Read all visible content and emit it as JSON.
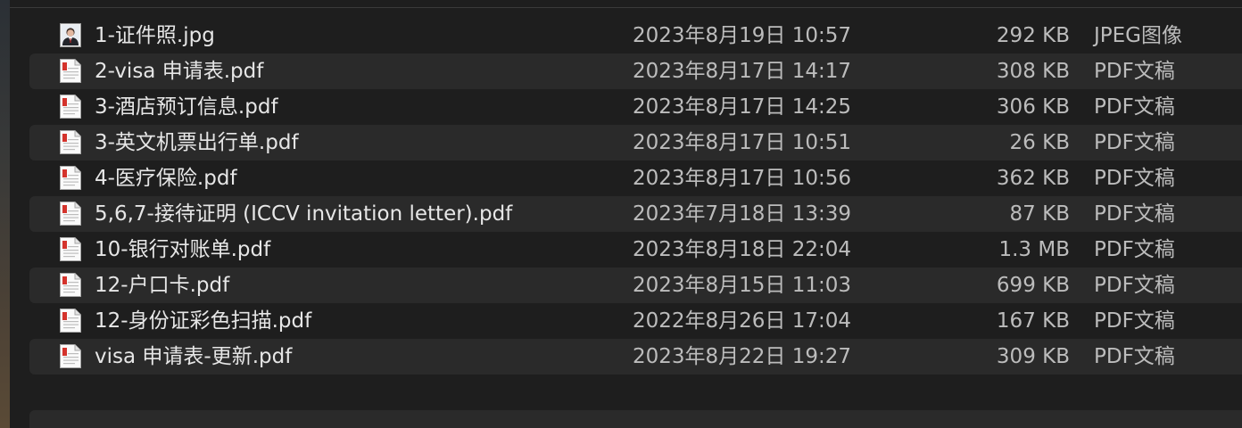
{
  "files": [
    {
      "name": "1-证件照.jpg",
      "date": "2023年8月19日 10:57",
      "size": "292 KB",
      "kind": "JPEG图像",
      "icon": "jpeg-photo-icon"
    },
    {
      "name": "2-visa 申请表.pdf",
      "date": "2023年8月17日 14:17",
      "size": "308 KB",
      "kind": "PDF文稿",
      "icon": "pdf-document-icon"
    },
    {
      "name": "3-酒店预订信息.pdf",
      "date": "2023年8月17日 14:25",
      "size": "306 KB",
      "kind": "PDF文稿",
      "icon": "pdf-document-icon"
    },
    {
      "name": "3-英文机票出行单.pdf",
      "date": "2023年8月17日 10:51",
      "size": "26 KB",
      "kind": "PDF文稿",
      "icon": "pdf-document-icon"
    },
    {
      "name": "4-医疗保险.pdf",
      "date": "2023年8月17日 10:56",
      "size": "362 KB",
      "kind": "PDF文稿",
      "icon": "pdf-document-icon"
    },
    {
      "name": "5,6,7-接待证明 (ICCV invitation letter).pdf",
      "date": "2023年7月18日 13:39",
      "size": "87 KB",
      "kind": "PDF文稿",
      "icon": "pdf-document-icon"
    },
    {
      "name": "10-银行对账单.pdf",
      "date": "2023年8月18日 22:04",
      "size": "1.3 MB",
      "kind": "PDF文稿",
      "icon": "pdf-document-icon"
    },
    {
      "name": "12-户口卡.pdf",
      "date": "2023年8月15日 11:03",
      "size": "699 KB",
      "kind": "PDF文稿",
      "icon": "pdf-document-icon"
    },
    {
      "name": "12-身份证彩色扫描.pdf",
      "date": "2022年8月26日 17:04",
      "size": "167 KB",
      "kind": "PDF文稿",
      "icon": "pdf-document-icon"
    },
    {
      "name": "visa 申请表-更新.pdf",
      "date": "2023年8月22日 19:27",
      "size": "309 KB",
      "kind": "PDF文稿",
      "icon": "pdf-document-icon"
    }
  ],
  "colors": {
    "background": "#1e1e1e",
    "stripe": "#2a2a2a",
    "pdf_red": "#d4332c"
  }
}
